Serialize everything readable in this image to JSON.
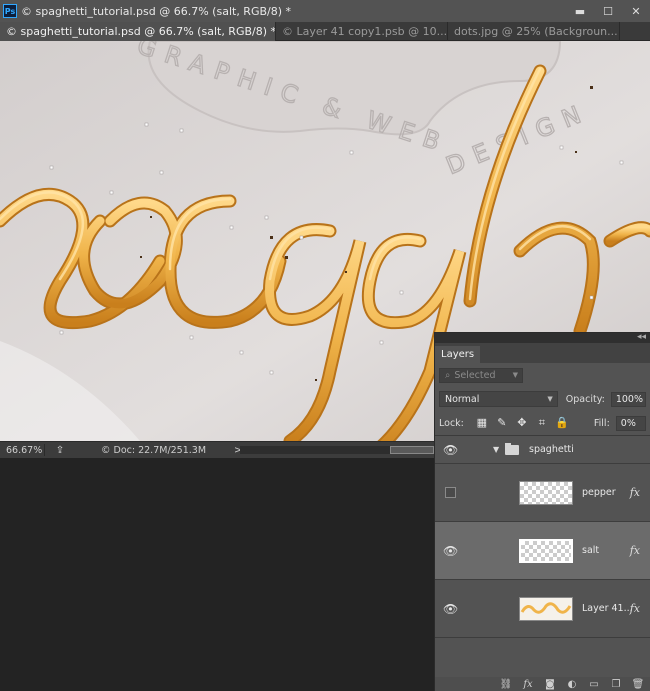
{
  "app": {
    "logo": "Ps",
    "window_title": "© spaghetti_tutorial.psd @ 66.7% (salt, RGB/8) *",
    "controls": {
      "minimize": "▬",
      "maximize": "☐",
      "close": "✕"
    }
  },
  "tabs": [
    {
      "label": "© spaghetti_tutorial.psd @ 66.7% (salt, RGB/8) *",
      "close": "×",
      "active": true
    },
    {
      "label": "© Layer 41 copy1.psb @ 10...",
      "close": "×",
      "active": false
    },
    {
      "label": "dots.jpg @ 25% (Backgroun...",
      "close": "×",
      "active": false
    }
  ],
  "canvas": {
    "watermark_top": "GRAPHIC & WEB",
    "watermark_right": "DESIGN",
    "colors": {
      "background": "#dcd7d6",
      "pasta": "#f0b44a",
      "pasta_dark": "#c97f1c",
      "pasta_light": "#ffd98a"
    }
  },
  "status": {
    "zoom": "66.67%",
    "share_icon": "share-icon",
    "doc": "© Doc: 22.7M/251.3M",
    "arrow": ">",
    "scroll_left": "<"
  },
  "layers_panel": {
    "tab": "Layers",
    "collapse_glyph": "◂◂",
    "filter_label": "Selected",
    "blend_mode": "Normal",
    "opacity_label": "Opacity:",
    "opacity_value": "100%",
    "lock_label": "Lock:",
    "fill_label": "Fill:",
    "fill_value": "0%",
    "group_name": "spaghetti",
    "layers": [
      {
        "name": "pepper",
        "visible": false,
        "fx": "fx",
        "selected": false
      },
      {
        "name": "salt",
        "visible": true,
        "fx": "fx",
        "selected": true
      },
      {
        "name": "Layer 41...",
        "visible": true,
        "fx": "fx",
        "selected": false
      }
    ],
    "bottom_icons": [
      "link-icon",
      "fx-icon",
      "mask-icon",
      "adjustment-icon",
      "folder-icon",
      "new-layer-icon",
      "trash-icon"
    ],
    "bottom_fx": "fx"
  }
}
